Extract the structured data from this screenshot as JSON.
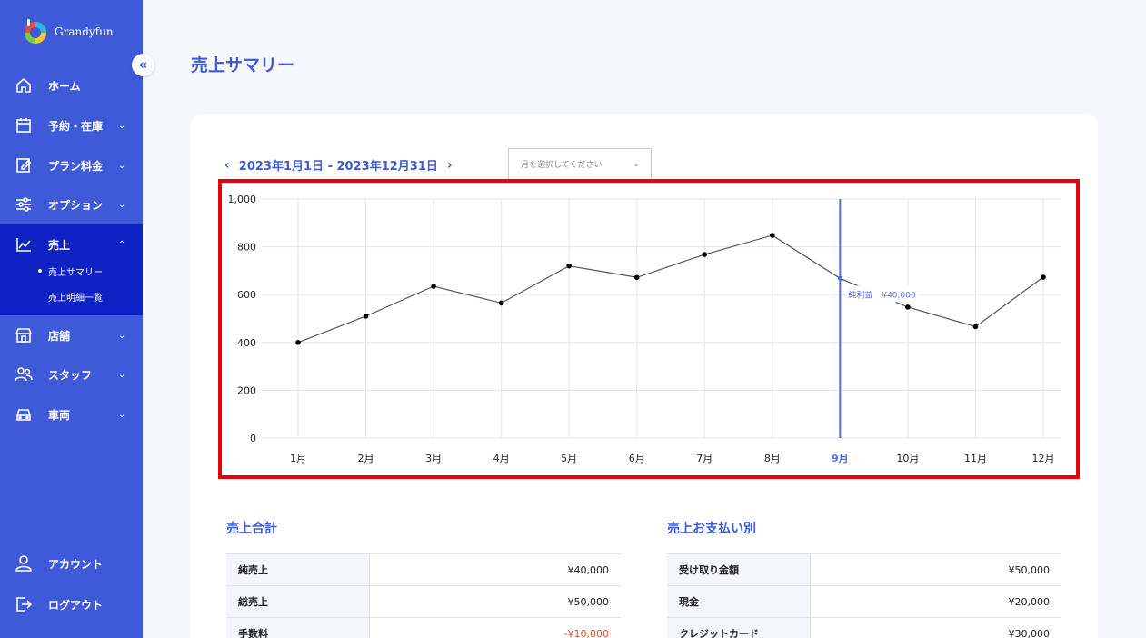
{
  "app": {
    "name": "Grandyfun"
  },
  "sidebar": {
    "collapse_icon": "double-chevron-left-icon",
    "items": [
      {
        "label": "ホーム",
        "icon": "home-icon"
      },
      {
        "label": "予約・在庫",
        "icon": "calendar-icon"
      },
      {
        "label": "プラン料金",
        "icon": "edit-icon"
      },
      {
        "label": "オプション",
        "icon": "sliders-icon"
      },
      {
        "label": "売上",
        "icon": "chart-line-icon"
      },
      {
        "label": "店舗",
        "icon": "store-icon"
      },
      {
        "label": "スタッフ",
        "icon": "users-icon"
      },
      {
        "label": "車両",
        "icon": "car-icon"
      }
    ],
    "sub_items": [
      {
        "label": "売上サマリー",
        "active": true
      },
      {
        "label": "売上明細一覧",
        "active": false
      }
    ],
    "bottom": [
      {
        "label": "アカウント",
        "icon": "user-icon"
      },
      {
        "label": "ログアウト",
        "icon": "logout-icon"
      }
    ]
  },
  "page": {
    "title": "売上サマリー"
  },
  "filter": {
    "date_range": "2023年1月1日 - 2023年12月31日",
    "month_placeholder": "月を選択してください"
  },
  "chart_data": {
    "type": "line",
    "categories": [
      "1月",
      "2月",
      "3月",
      "4月",
      "5月",
      "6月",
      "7月",
      "8月",
      "9月",
      "10月",
      "11月",
      "12月"
    ],
    "values": [
      400,
      510,
      635,
      565,
      720,
      672,
      768,
      848,
      668,
      548,
      466,
      673
    ],
    "ylim": [
      0,
      1000
    ],
    "yticks": [
      "0",
      "200",
      "400",
      "600",
      "800",
      "1,000"
    ],
    "highlight_category": "9月",
    "tooltip": {
      "label": "純利益",
      "value": "¥40,000"
    },
    "grid": true,
    "colors": {
      "line": "#555555",
      "point": "#000000",
      "highlight": "#4f6ee8"
    }
  },
  "summary": {
    "title": "売上合計",
    "rows": [
      {
        "label": "純売上",
        "value": "¥40,000"
      },
      {
        "label": "総売上",
        "value": "¥50,000"
      },
      {
        "label": "手数料",
        "value": "-¥10,000"
      }
    ]
  },
  "payments": {
    "title": "売上お支払い別",
    "rows": [
      {
        "label": "受け取り金額",
        "value": "¥50,000"
      },
      {
        "label": "現金",
        "value": "¥20,000"
      },
      {
        "label": "クレジットカード",
        "value": "¥30,000"
      }
    ]
  },
  "colors": {
    "brand": "#3f5ad9",
    "active_nav": "#0f22c4",
    "alert": "#e8000b"
  }
}
